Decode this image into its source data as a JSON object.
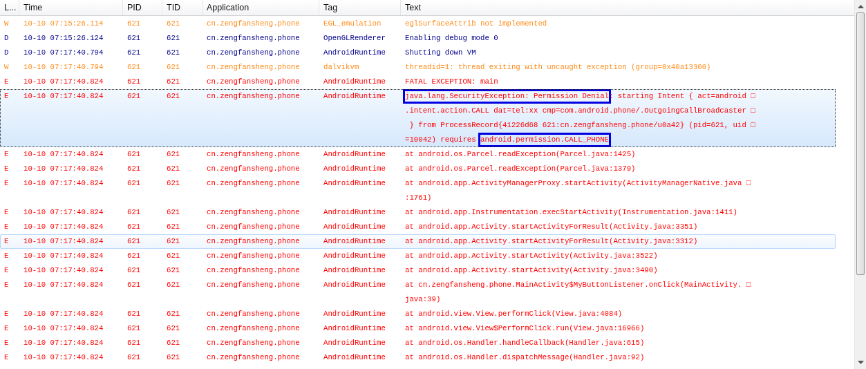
{
  "table": {
    "columns": [
      "L...",
      "Time",
      "PID",
      "TID",
      "Application",
      "Tag",
      "Text"
    ],
    "rows": [
      {
        "priority": "W",
        "color": "#ff8c1a",
        "time": "10-10 07:15:26.114",
        "pid": "621",
        "tid": "621",
        "application": "cn.zengfansheng.phone",
        "tag": "EGL_emulation",
        "selected": false,
        "hovered": false,
        "lines": [
          [
            {
              "text": "eglSurfaceAttrib not implemented",
              "boxed": false
            }
          ]
        ]
      },
      {
        "priority": "D",
        "color": "#00008b",
        "time": "10-10 07:15:26.124",
        "pid": "621",
        "tid": "621",
        "application": "cn.zengfansheng.phone",
        "tag": "OpenGLRenderer",
        "selected": false,
        "hovered": false,
        "lines": [
          [
            {
              "text": "Enabling debug mode 0",
              "boxed": false
            }
          ]
        ]
      },
      {
        "priority": "D",
        "color": "#00008b",
        "time": "10-10 07:17:40.794",
        "pid": "621",
        "tid": "621",
        "application": "cn.zengfansheng.phone",
        "tag": "AndroidRuntime",
        "selected": false,
        "hovered": false,
        "lines": [
          [
            {
              "text": "Shutting down VM",
              "boxed": false
            }
          ]
        ]
      },
      {
        "priority": "W",
        "color": "#ff8c1a",
        "time": "10-10 07:17:40.794",
        "pid": "621",
        "tid": "621",
        "application": "cn.zengfansheng.phone",
        "tag": "dalvikvm",
        "selected": false,
        "hovered": false,
        "lines": [
          [
            {
              "text": "threadid=1: thread exiting with uncaught exception (group=0x40a13300)",
              "boxed": false
            }
          ]
        ]
      },
      {
        "priority": "E",
        "color": "#ff0000",
        "time": "10-10 07:17:40.824",
        "pid": "621",
        "tid": "621",
        "application": "cn.zengfansheng.phone",
        "tag": "AndroidRuntime",
        "selected": false,
        "hovered": false,
        "lines": [
          [
            {
              "text": "FATAL EXCEPTION: main",
              "boxed": false
            }
          ]
        ]
      },
      {
        "priority": "E",
        "color": "#ff0000",
        "time": "10-10 07:17:40.824",
        "pid": "621",
        "tid": "621",
        "application": "cn.zengfansheng.phone",
        "tag": "AndroidRuntime",
        "selected": true,
        "hovered": false,
        "lines": [
          [
            {
              "text": "java.lang.SecurityException: Permission Denial",
              "boxed": true
            },
            {
              "text": ": starting Intent { act=android □",
              "boxed": false
            }
          ],
          [
            {
              "text": ".intent.action.CALL dat=tel:xx cmp=com.android.phone/.OutgoingCallBroadcaster □",
              "boxed": false
            }
          ],
          [
            {
              "text": " } from ProcessRecord{41226d68 621:cn.zengfansheng.phone/u0a42} (pid=621, uid □",
              "boxed": false
            }
          ],
          [
            {
              "text": "=10042) requires ",
              "boxed": false
            },
            {
              "text": "android.permission.CALL_PHONE",
              "boxed": true
            }
          ]
        ]
      },
      {
        "priority": "E",
        "color": "#ff0000",
        "time": "10-10 07:17:40.824",
        "pid": "621",
        "tid": "621",
        "application": "cn.zengfansheng.phone",
        "tag": "AndroidRuntime",
        "selected": false,
        "hovered": false,
        "lines": [
          [
            {
              "text": "at android.os.Parcel.readException(Parcel.java:1425)",
              "boxed": false
            }
          ]
        ]
      },
      {
        "priority": "E",
        "color": "#ff0000",
        "time": "10-10 07:17:40.824",
        "pid": "621",
        "tid": "621",
        "application": "cn.zengfansheng.phone",
        "tag": "AndroidRuntime",
        "selected": false,
        "hovered": false,
        "lines": [
          [
            {
              "text": "at android.os.Parcel.readException(Parcel.java:1379)",
              "boxed": false
            }
          ]
        ]
      },
      {
        "priority": "E",
        "color": "#ff0000",
        "time": "10-10 07:17:40.824",
        "pid": "621",
        "tid": "621",
        "application": "cn.zengfansheng.phone",
        "tag": "AndroidRuntime",
        "selected": false,
        "hovered": false,
        "lines": [
          [
            {
              "text": "at android.app.ActivityManagerProxy.startActivity(ActivityManagerNative.java □",
              "boxed": false
            }
          ],
          [
            {
              "text": ":1761)",
              "boxed": false
            }
          ]
        ]
      },
      {
        "priority": "E",
        "color": "#ff0000",
        "time": "10-10 07:17:40.824",
        "pid": "621",
        "tid": "621",
        "application": "cn.zengfansheng.phone",
        "tag": "AndroidRuntime",
        "selected": false,
        "hovered": false,
        "lines": [
          [
            {
              "text": "at android.app.Instrumentation.execStartActivity(Instrumentation.java:1411)",
              "boxed": false
            }
          ]
        ]
      },
      {
        "priority": "E",
        "color": "#ff0000",
        "time": "10-10 07:17:40.824",
        "pid": "621",
        "tid": "621",
        "application": "cn.zengfansheng.phone",
        "tag": "AndroidRuntime",
        "selected": false,
        "hovered": false,
        "lines": [
          [
            {
              "text": "at android.app.Activity.startActivityForResult(Activity.java:3351)",
              "boxed": false
            }
          ]
        ]
      },
      {
        "priority": "E",
        "color": "#ff0000",
        "time": "10-10 07:17:40.824",
        "pid": "621",
        "tid": "621",
        "application": "cn.zengfansheng.phone",
        "tag": "AndroidRuntime",
        "selected": false,
        "hovered": true,
        "lines": [
          [
            {
              "text": "at android.app.Activity.startActivityForResult(Activity.java:3312)",
              "boxed": false
            }
          ]
        ]
      },
      {
        "priority": "E",
        "color": "#ff0000",
        "time": "10-10 07:17:40.824",
        "pid": "621",
        "tid": "621",
        "application": "cn.zengfansheng.phone",
        "tag": "AndroidRuntime",
        "selected": false,
        "hovered": false,
        "lines": [
          [
            {
              "text": "at android.app.Activity.startActivity(Activity.java:3522)",
              "boxed": false
            }
          ]
        ]
      },
      {
        "priority": "E",
        "color": "#ff0000",
        "time": "10-10 07:17:40.824",
        "pid": "621",
        "tid": "621",
        "application": "cn.zengfansheng.phone",
        "tag": "AndroidRuntime",
        "selected": false,
        "hovered": false,
        "lines": [
          [
            {
              "text": "at android.app.Activity.startActivity(Activity.java:3490)",
              "boxed": false
            }
          ]
        ]
      },
      {
        "priority": "E",
        "color": "#ff0000",
        "time": "10-10 07:17:40.824",
        "pid": "621",
        "tid": "621",
        "application": "cn.zengfansheng.phone",
        "tag": "AndroidRuntime",
        "selected": false,
        "hovered": false,
        "lines": [
          [
            {
              "text": "at cn.zengfansheng.phone.MainActivity$MyButtonListener.onClick(MainActivity. □",
              "boxed": false
            }
          ],
          [
            {
              "text": "java:39)",
              "boxed": false
            }
          ]
        ]
      },
      {
        "priority": "E",
        "color": "#ff0000",
        "time": "10-10 07:17:40.824",
        "pid": "621",
        "tid": "621",
        "application": "cn.zengfansheng.phone",
        "tag": "AndroidRuntime",
        "selected": false,
        "hovered": false,
        "lines": [
          [
            {
              "text": "at android.view.View.performClick(View.java:4084)",
              "boxed": false
            }
          ]
        ]
      },
      {
        "priority": "E",
        "color": "#ff0000",
        "time": "10-10 07:17:40.824",
        "pid": "621",
        "tid": "621",
        "application": "cn.zengfansheng.phone",
        "tag": "AndroidRuntime",
        "selected": false,
        "hovered": false,
        "lines": [
          [
            {
              "text": "at android.view.View$PerformClick.run(View.java:16966)",
              "boxed": false
            }
          ]
        ]
      },
      {
        "priority": "E",
        "color": "#ff0000",
        "time": "10-10 07:17:40.824",
        "pid": "621",
        "tid": "621",
        "application": "cn.zengfansheng.phone",
        "tag": "AndroidRuntime",
        "selected": false,
        "hovered": false,
        "lines": [
          [
            {
              "text": "at android.os.Handler.handleCallback(Handler.java:615)",
              "boxed": false
            }
          ]
        ]
      },
      {
        "priority": "E",
        "color": "#ff0000",
        "time": "10-10 07:17:40.824",
        "pid": "621",
        "tid": "621",
        "application": "cn.zengfansheng.phone",
        "tag": "AndroidRuntime",
        "selected": false,
        "hovered": false,
        "lines": [
          [
            {
              "text": "at android.os.Handler.dispatchMessage(Handler.java:92)",
              "boxed": false
            }
          ]
        ]
      }
    ]
  }
}
